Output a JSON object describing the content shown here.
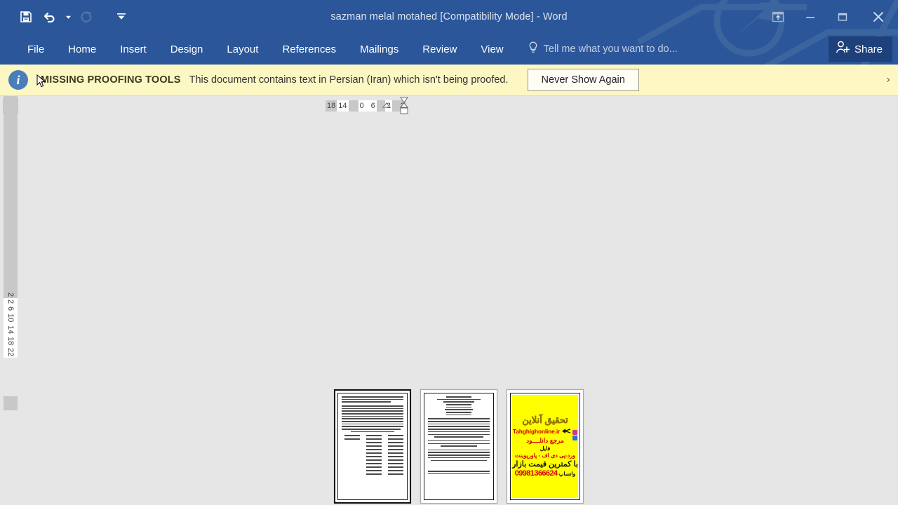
{
  "window": {
    "title": "sazman melal motahed [Compatibility Mode] - Word",
    "accent_color": "#2b579a"
  },
  "quick_access": {
    "items": [
      {
        "name": "save-icon",
        "label": "Save",
        "enabled": true
      },
      {
        "name": "undo-icon",
        "label": "Undo",
        "enabled": true
      },
      {
        "name": "undo-dropdown-icon",
        "label": "Undo options",
        "enabled": true
      },
      {
        "name": "redo-icon",
        "label": "Redo",
        "enabled": false
      },
      {
        "name": "customize-quick-access-icon",
        "label": "Customize Quick Access Toolbar",
        "enabled": true
      }
    ]
  },
  "window_controls": {
    "ribbon_display_options": "Ribbon Display Options",
    "minimize": "Minimize",
    "restore": "Restore Down",
    "close": "Close"
  },
  "ribbon": {
    "tabs": [
      {
        "label": "File",
        "active": false
      },
      {
        "label": "Home",
        "active": false
      },
      {
        "label": "Insert",
        "active": false
      },
      {
        "label": "Design",
        "active": false
      },
      {
        "label": "Layout",
        "active": false
      },
      {
        "label": "References",
        "active": false
      },
      {
        "label": "Mailings",
        "active": false
      },
      {
        "label": "Review",
        "active": false
      },
      {
        "label": "View",
        "active": false
      }
    ],
    "tell_me": "Tell me what you want to do...",
    "share_label": "Share"
  },
  "message_bar": {
    "icon": "info-icon",
    "heading": "MISSING PROOFING TOOLS",
    "text": "This document contains text in Persian (Iran) which isn't being proofed.",
    "button_label": "Never Show Again",
    "close_label": "Close message bar",
    "background_color": "#fdf7c3"
  },
  "rulers": {
    "tab_stop_selector": "left-tab-stop",
    "horizontal": {
      "segments": [
        {
          "text": "18",
          "shade": "gray"
        },
        {
          "text": "14",
          "shade": "white"
        },
        {
          "text": "",
          "shade": "gray"
        },
        {
          "text": "0",
          "shade": "white"
        },
        {
          "text": "6",
          "shade": "white"
        },
        {
          "text": "",
          "shade": "gray"
        },
        {
          "text": "2",
          "shade": "white"
        },
        {
          "text": "",
          "shade": "gray"
        },
        {
          "text": "2",
          "shade": "gray"
        }
      ],
      "markers": [
        "first-line-indent",
        "hanging-indent",
        "left-indent",
        "right-indent"
      ]
    },
    "vertical": {
      "segments": [
        {
          "text": "2",
          "shade": "gray"
        },
        {
          "text": "2",
          "shade": "white"
        },
        {
          "text": "6",
          "shade": "white"
        },
        {
          "text": "10",
          "shade": "white"
        },
        {
          "text": "14",
          "shade": "white"
        },
        {
          "text": "18",
          "shade": "white"
        },
        {
          "text": "22",
          "shade": "white"
        }
      ]
    }
  },
  "document": {
    "zoom_view": "multiple-pages",
    "pages": [
      {
        "index": 1,
        "type": "text",
        "selected": false,
        "paragraph_line_widths": [
          [
            100,
            100,
            80
          ],
          [
            100,
            100,
            100,
            100,
            100,
            100,
            100,
            100,
            100,
            95,
            70
          ]
        ],
        "list_columns": 3,
        "list_rows": 12
      },
      {
        "index": 2,
        "type": "text",
        "selected": false,
        "header_line_widths": [
          40,
          70,
          55,
          45,
          40,
          45,
          40,
          35
        ],
        "paragraph_line_widths": [
          [
            100,
            100,
            100,
            100,
            100,
            100,
            100,
            80
          ],
          [
            100,
            100,
            60
          ],
          [
            100,
            100,
            100,
            100,
            90
          ],
          [
            100,
            100
          ]
        ]
      },
      {
        "index": 3,
        "type": "advertisement",
        "selected": false,
        "background_color": "#ffff00",
        "ad": {
          "title": "تحقیق آنلاین",
          "site": "Tahghighonline.ir",
          "line1": "مرجع دانلــــود",
          "line2": "فایل",
          "line3": "ورد-پی دی اف - پاورپوینت",
          "line4": "با کمترین قیمت بازار",
          "whatsapp_label": "واتساپ",
          "phone": "09981366624"
        }
      }
    ]
  }
}
